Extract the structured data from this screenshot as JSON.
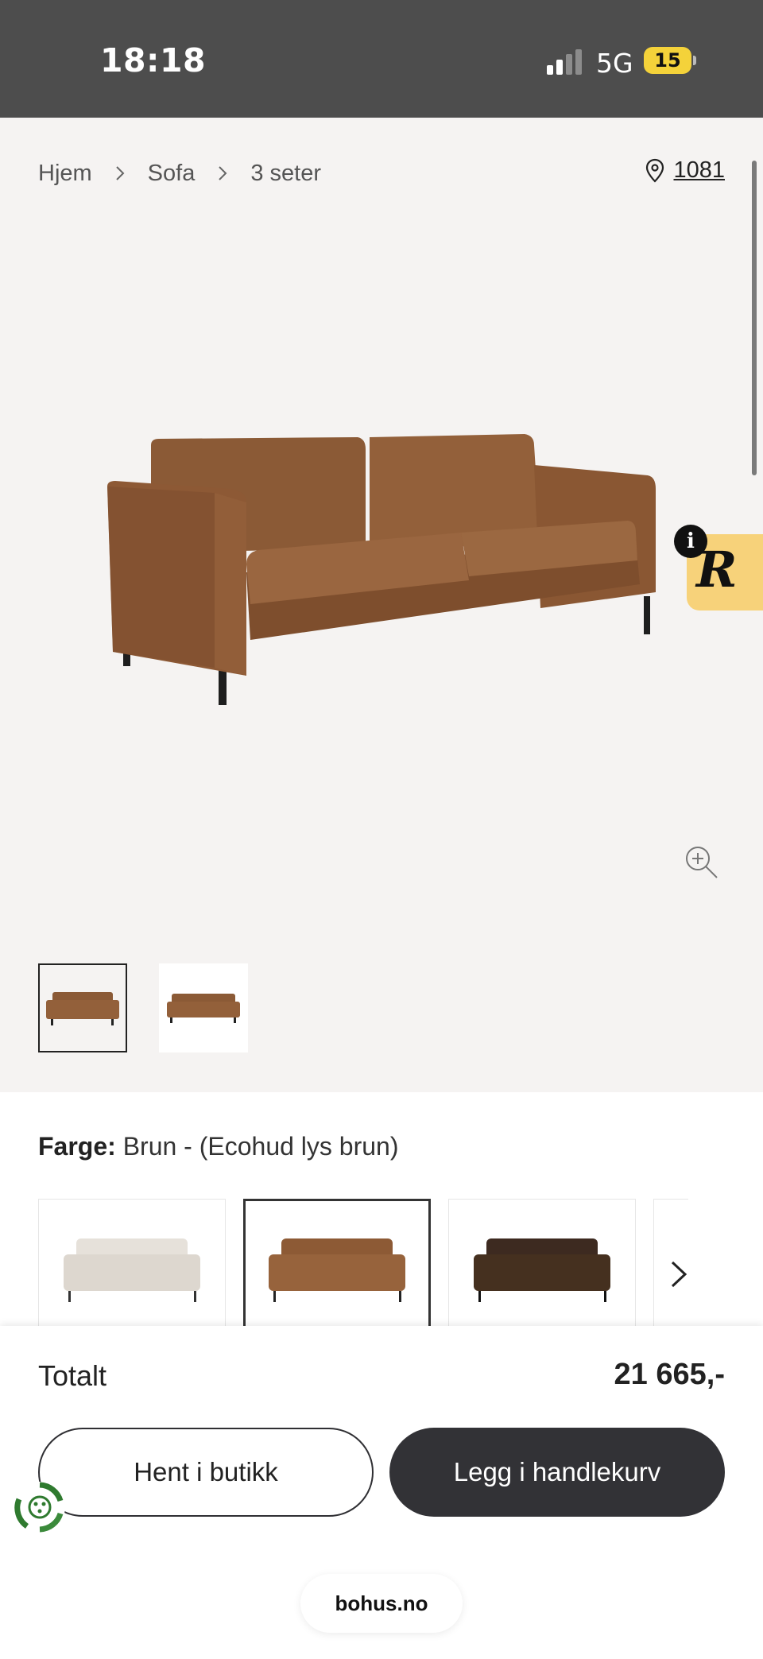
{
  "status_bar": {
    "time": "18:18",
    "network": "5G",
    "battery": "15"
  },
  "breadcrumb": {
    "items": [
      "Hjem",
      "Sofa",
      "3 seter"
    ]
  },
  "store": {
    "number": "1081"
  },
  "badge": {
    "info": "i",
    "letter": "R"
  },
  "product": {
    "color_label": "Farge:",
    "color_value": "Brun - (Ecohud lys brun)"
  },
  "purchase": {
    "total_label": "Totalt",
    "total_price": "21 665,-",
    "pickup_label": "Hent i butikk",
    "cart_label": "Legg i handlekurv"
  },
  "browser": {
    "url": "bohus.no"
  },
  "colors": {
    "accent": "#323236",
    "sofa": "#8f5a34",
    "background": "#f5f3f2",
    "badge": "#f7d27a"
  }
}
